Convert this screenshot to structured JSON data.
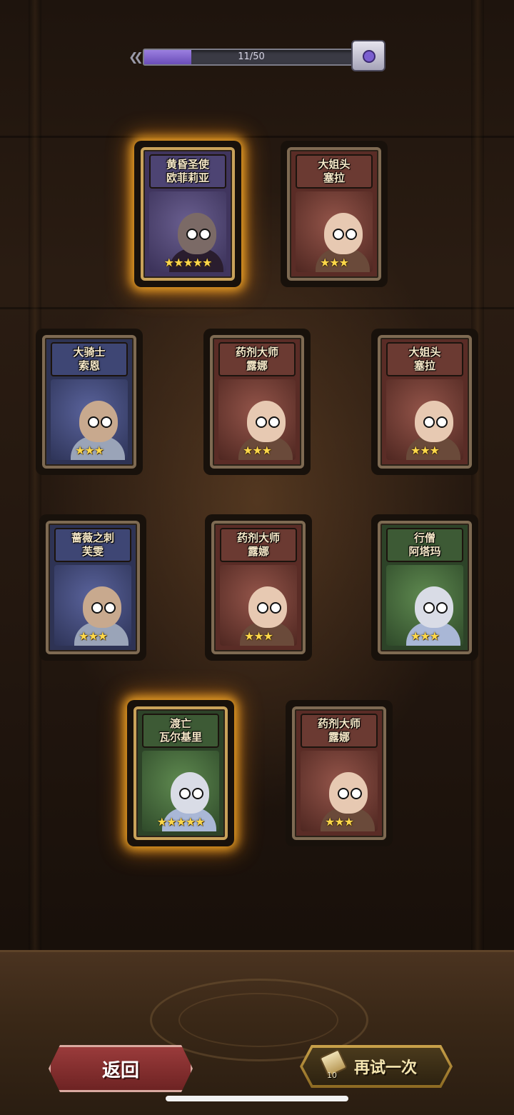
{
  "progress": {
    "text": "11/50",
    "current": 11,
    "max": 50
  },
  "cards": [
    {
      "line1": "黄昏圣使",
      "line2": "欧菲莉亚",
      "stars": "★★★★★",
      "star_count": 5,
      "theme": "purple",
      "legendary": true
    },
    {
      "line1": "大姐头",
      "line2": "塞拉",
      "stars": "★★★",
      "star_count": 3,
      "theme": "red",
      "legendary": false
    },
    {
      "line1": "大骑士",
      "line2": "索恩",
      "stars": "★★★",
      "star_count": 3,
      "theme": "blue",
      "legendary": false
    },
    {
      "line1": "药剂大师",
      "line2": "露娜",
      "stars": "★★★",
      "star_count": 3,
      "theme": "red",
      "legendary": false
    },
    {
      "line1": "大姐头",
      "line2": "塞拉",
      "stars": "★★★",
      "star_count": 3,
      "theme": "red",
      "legendary": false
    },
    {
      "line1": "蔷薇之刺",
      "line2": "芙雯",
      "stars": "★★★",
      "star_count": 3,
      "theme": "blue",
      "legendary": false
    },
    {
      "line1": "药剂大师",
      "line2": "露娜",
      "stars": "★★★",
      "star_count": 3,
      "theme": "red",
      "legendary": false
    },
    {
      "line1": "行僧",
      "line2": "阿塔玛",
      "stars": "★★★",
      "star_count": 3,
      "theme": "green",
      "legendary": false
    },
    {
      "line1": "渡亡",
      "line2": "瓦尔基里",
      "stars": "★★★★★",
      "star_count": 5,
      "theme": "green",
      "legendary": true
    },
    {
      "line1": "药剂大师",
      "line2": "露娜",
      "stars": "★★★",
      "star_count": 3,
      "theme": "red",
      "legendary": false
    }
  ],
  "buttons": {
    "back": "返回",
    "retry": "再试一次",
    "retry_cost": "10"
  },
  "icons": {
    "progress_chest": "chest-icon",
    "retry_cost": "scroll-icon"
  }
}
